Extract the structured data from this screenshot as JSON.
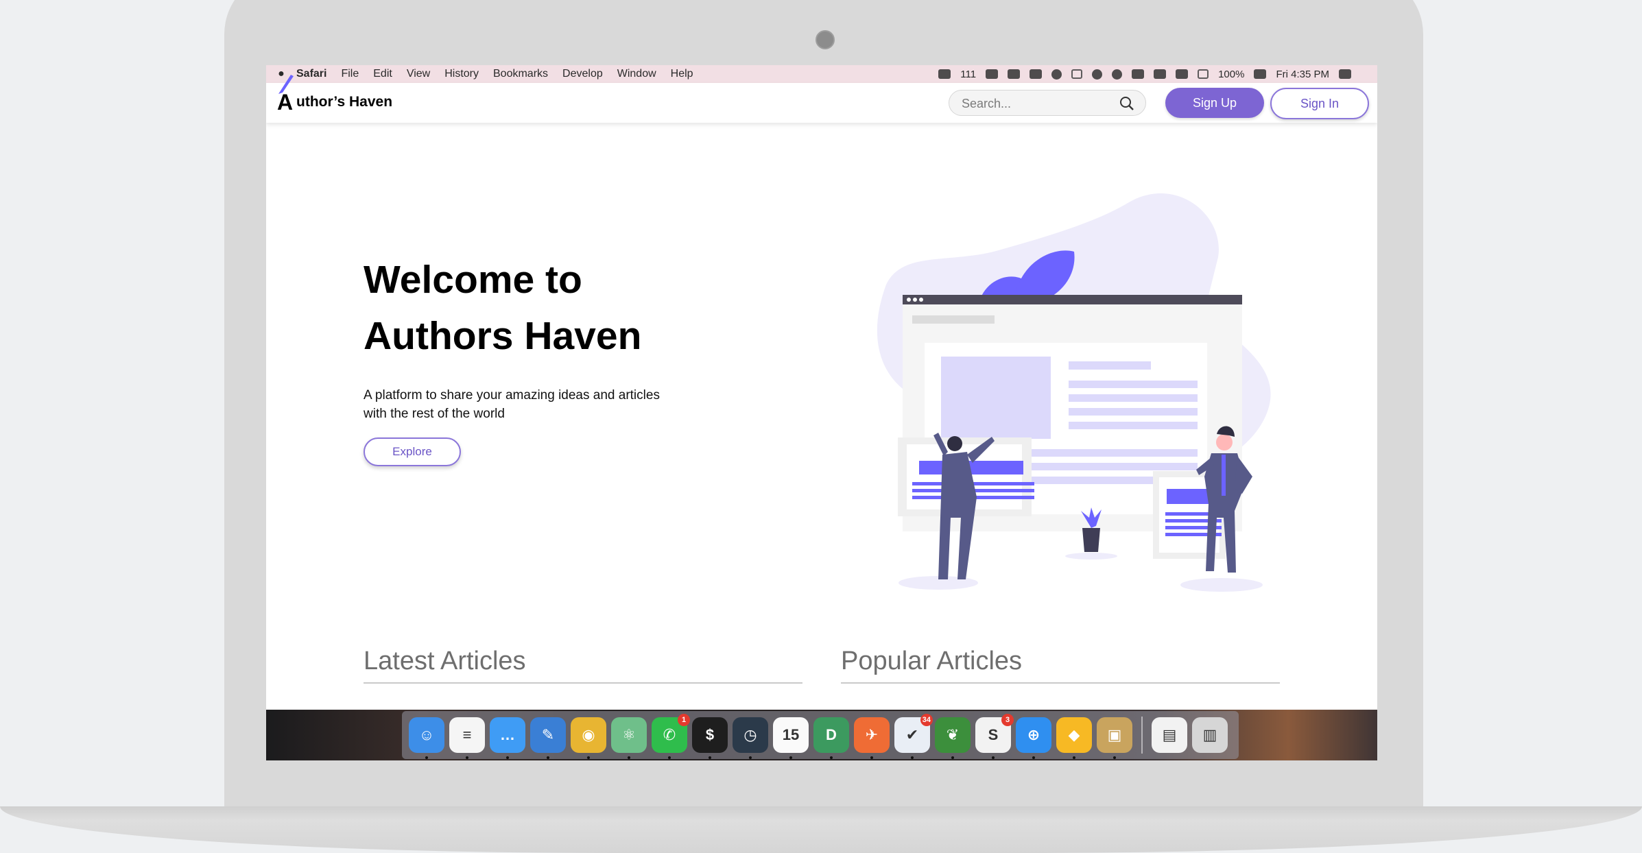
{
  "menubar": {
    "items": [
      "Safari",
      "File",
      "Edit",
      "View",
      "History",
      "Bookmarks",
      "Develop",
      "Window",
      "Help"
    ],
    "status": {
      "badge_count": "111",
      "battery": "100%",
      "clock": "Fri 4:35 PM"
    }
  },
  "site": {
    "logo_letter": "A",
    "logo_text": "uthor’s Haven",
    "search_placeholder": "Search...",
    "signup_label": "Sign Up",
    "signin_label": "Sign In"
  },
  "hero": {
    "title_line1": "Welcome to",
    "title_line2": "Authors Haven",
    "subtitle_line1": "A platform to share your amazing ideas and articles",
    "subtitle_line2": "with the rest of the world",
    "explore_label": "Explore"
  },
  "sections": {
    "latest": "Latest Articles",
    "popular": "Popular Articles"
  },
  "colors": {
    "accent": "#7d65d3",
    "illustration_purple": "#6c63ff",
    "menubar": "#f2dfe4"
  },
  "dock": {
    "apps": [
      {
        "name": "finder-icon",
        "color": "#3d8ee8",
        "glyph": "☺"
      },
      {
        "name": "reminders-icon",
        "color": "#f5f5f5",
        "glyph": "≡"
      },
      {
        "name": "messages-icon",
        "color": "#3f9cf5",
        "glyph": "…"
      },
      {
        "name": "xcode-icon",
        "color": "#3a7fd5",
        "glyph": "✎"
      },
      {
        "name": "chrome-icon",
        "color": "#e8b532",
        "glyph": "◉"
      },
      {
        "name": "atom-icon",
        "color": "#6fbf8a",
        "glyph": "⚛"
      },
      {
        "name": "whatsapp-icon",
        "color": "#2fbd4c",
        "glyph": "✆",
        "badge": "1"
      },
      {
        "name": "terminal-icon",
        "color": "#1e1e1e",
        "glyph": "$"
      },
      {
        "name": "time-machine-icon",
        "color": "#2b3a4a",
        "glyph": "◷"
      },
      {
        "name": "calendar-icon",
        "color": "#fafafa",
        "glyph": "15"
      },
      {
        "name": "dash-icon",
        "color": "#3c9a5f",
        "glyph": "D"
      },
      {
        "name": "postman-icon",
        "color": "#ef6c35",
        "glyph": "✈"
      },
      {
        "name": "mail-icon",
        "color": "#e9eef5",
        "glyph": "✔",
        "badge": "34"
      },
      {
        "name": "evernote-icon",
        "color": "#3c8f3c",
        "glyph": "❦"
      },
      {
        "name": "slack-icon",
        "color": "#f2f2f2",
        "glyph": "S",
        "badge": "3"
      },
      {
        "name": "safari-icon",
        "color": "#2f8ff0",
        "glyph": "⊕"
      },
      {
        "name": "sketch-icon",
        "color": "#f7b924",
        "glyph": "◆"
      },
      {
        "name": "preview-icon",
        "color": "#c9a45e",
        "glyph": "▣"
      },
      {
        "name": "document-icon",
        "color": "#f2f2f2",
        "glyph": "▤"
      },
      {
        "name": "trash-icon",
        "color": "#d6d6d6",
        "glyph": "▥"
      }
    ]
  }
}
